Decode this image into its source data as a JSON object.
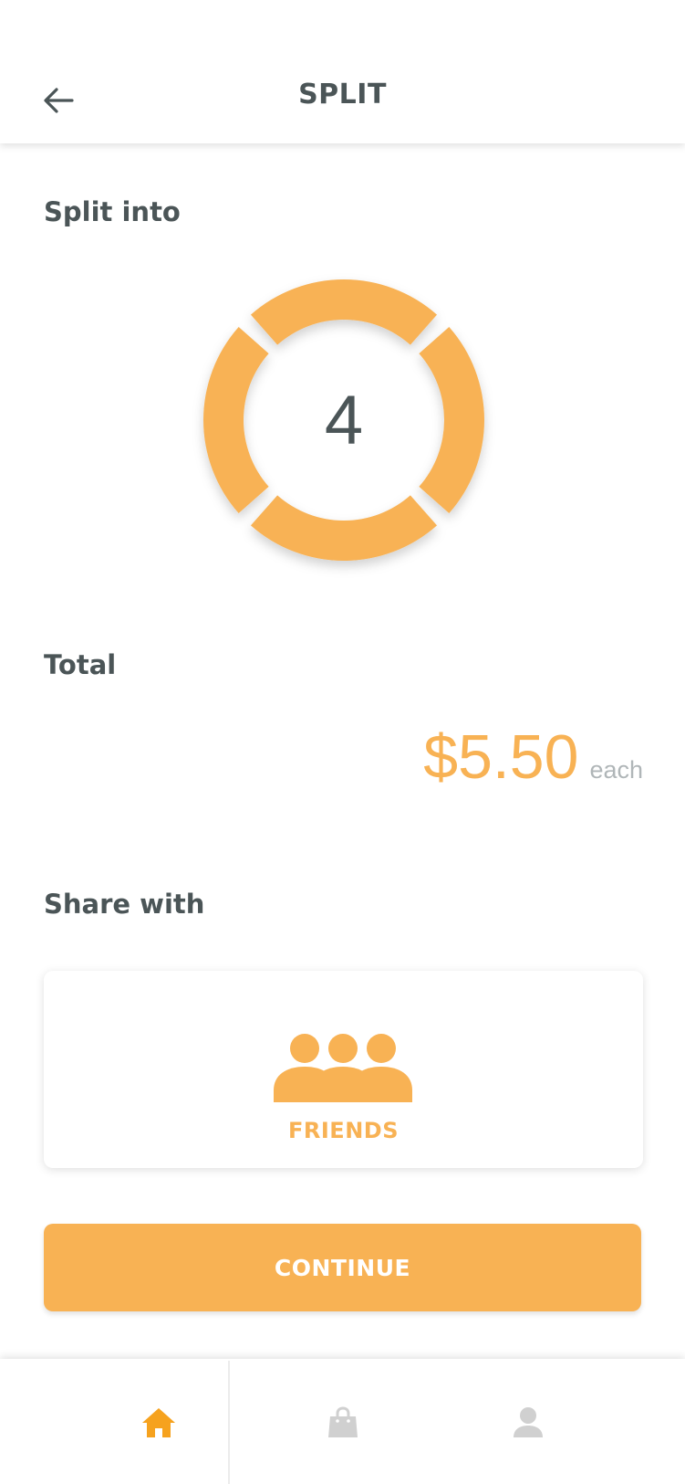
{
  "header": {
    "title": "SPLIT",
    "back_icon": "arrow-left-icon"
  },
  "split": {
    "label": "Split into",
    "count": "4",
    "segments": 4
  },
  "total": {
    "label": "Total",
    "amount": "$5.50",
    "suffix": "each"
  },
  "share": {
    "label": "Share with",
    "option_label": "FRIENDS",
    "option_icon": "friends-icon"
  },
  "actions": {
    "continue_label": "CONTINUE"
  },
  "bottom_nav": {
    "items": [
      {
        "icon": "home-icon",
        "active": true
      },
      {
        "icon": "shopping-bag-icon",
        "active": false
      },
      {
        "icon": "user-icon",
        "active": false
      }
    ]
  },
  "colors": {
    "accent": "#f8b254",
    "text_dark": "#4b5557",
    "text_muted": "#b0b6b8",
    "nav_inactive": "#d0d0d0",
    "nav_active": "#f6a21e"
  }
}
